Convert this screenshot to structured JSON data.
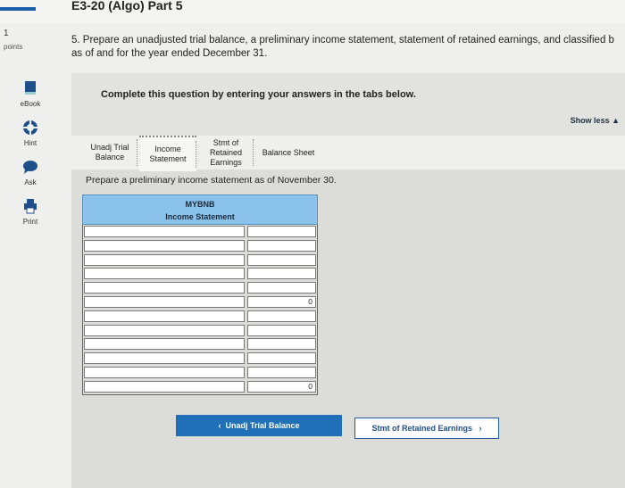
{
  "header": {
    "title": "E3-20 (Algo) Part 5"
  },
  "sidebar": {
    "points_value": "1",
    "points_label": "points",
    "tools": [
      {
        "label": "eBook",
        "icon": "ebook-icon"
      },
      {
        "label": "Hint",
        "icon": "hint-icon"
      },
      {
        "label": "Ask",
        "icon": "ask-icon"
      },
      {
        "label": "Print",
        "icon": "print-icon"
      }
    ]
  },
  "question": {
    "text_line1": "5. Prepare an unadjusted trial balance, a preliminary income statement, statement of retained earnings, and classified b",
    "text_line2": "as of and for the year ended December 31."
  },
  "panel": {
    "instruction": "Complete this question by entering your answers in the tabs below.",
    "show_less": "Show less ▲"
  },
  "tabs": [
    {
      "line1": "Unadj Trial",
      "line2": "Balance",
      "line3": ""
    },
    {
      "line1": "Income",
      "line2": "Statement",
      "line3": ""
    },
    {
      "line1": "Stmt of",
      "line2": "Retained",
      "line3": "Earnings"
    },
    {
      "line1": "Balance Sheet",
      "line2": "",
      "line3": ""
    }
  ],
  "work": {
    "prompt": "Prepare a preliminary income statement as of November 30.",
    "company": "MYBNB",
    "statement": "Income Statement",
    "rows": [
      "",
      "",
      "",
      "",
      "",
      "0",
      "",
      "",
      "",
      "",
      "",
      "0"
    ]
  },
  "nav": {
    "prev_label": "Unadj Trial Balance",
    "next_label": "Stmt of Retained Earnings"
  },
  "colors": {
    "accent": "#1f6fb9",
    "header_blue": "#8ac2ec"
  }
}
